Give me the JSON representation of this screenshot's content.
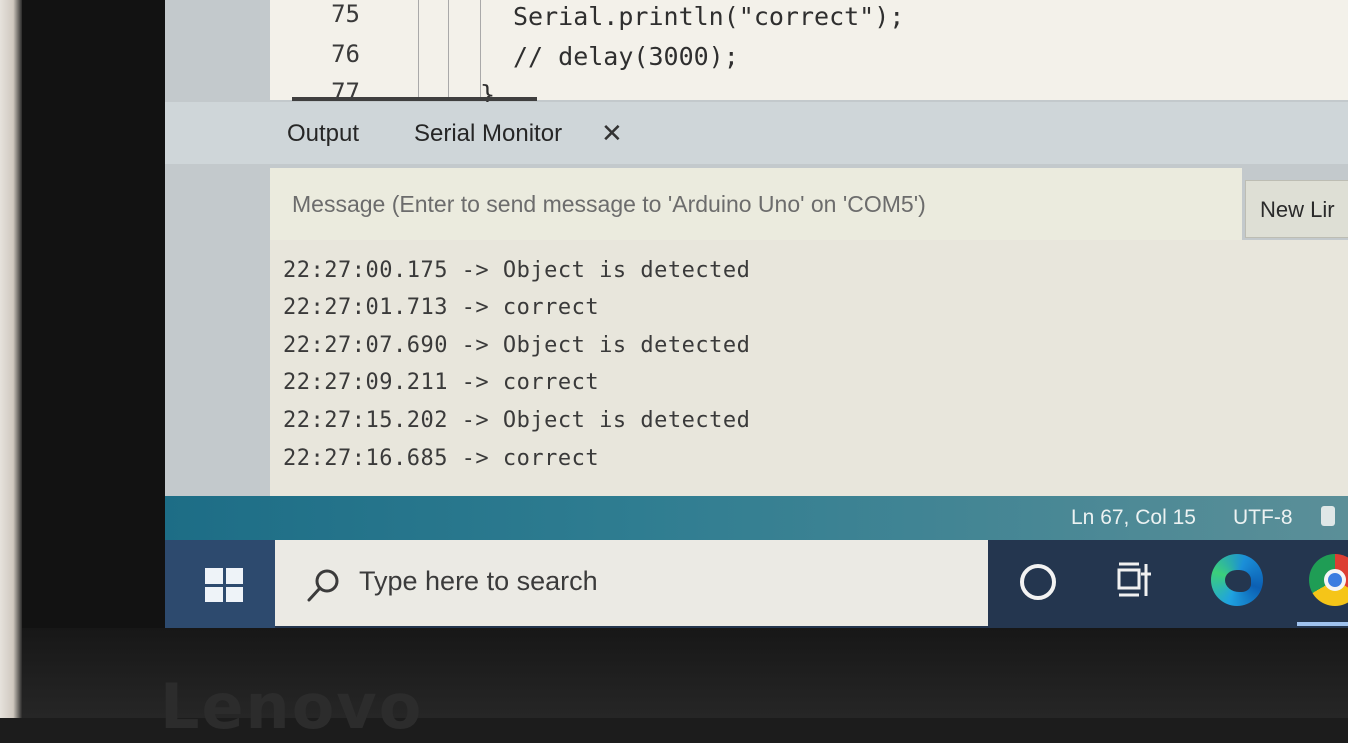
{
  "editor": {
    "lines": [
      {
        "number": "75",
        "code": "Serial.println(\"correct\");"
      },
      {
        "number": "76",
        "code": "// delay(3000);"
      },
      {
        "number": "77",
        "code": "}"
      }
    ]
  },
  "panel": {
    "tabs": [
      {
        "label": "Output"
      },
      {
        "label": "Serial Monitor"
      }
    ],
    "close_symbol": "✕"
  },
  "serial_monitor": {
    "message_placeholder": "Message (Enter to send message to 'Arduino Uno' on 'COM5')",
    "line_ending": "New Lir",
    "log": [
      "22:27:00.175 -> Object is detected",
      "22:27:01.713 -> correct",
      "22:27:07.690 -> Object is detected",
      "22:27:09.211 -> correct",
      "22:27:15.202 -> Object is detected",
      "22:27:16.685 -> correct"
    ]
  },
  "status_bar": {
    "position": "Ln 67, Col 15",
    "encoding": "UTF-8"
  },
  "taskbar": {
    "search_placeholder": "Type here to search",
    "icons": [
      "windows-start-icon",
      "search-icon",
      "cortana-icon",
      "task-view-icon",
      "edge-icon",
      "chrome-icon"
    ]
  },
  "device": {
    "brand": "Lenovo"
  },
  "colors": {
    "status_bar": "#1d6d86",
    "taskbar": "#24364f",
    "log_background": "#e8e6dc"
  }
}
